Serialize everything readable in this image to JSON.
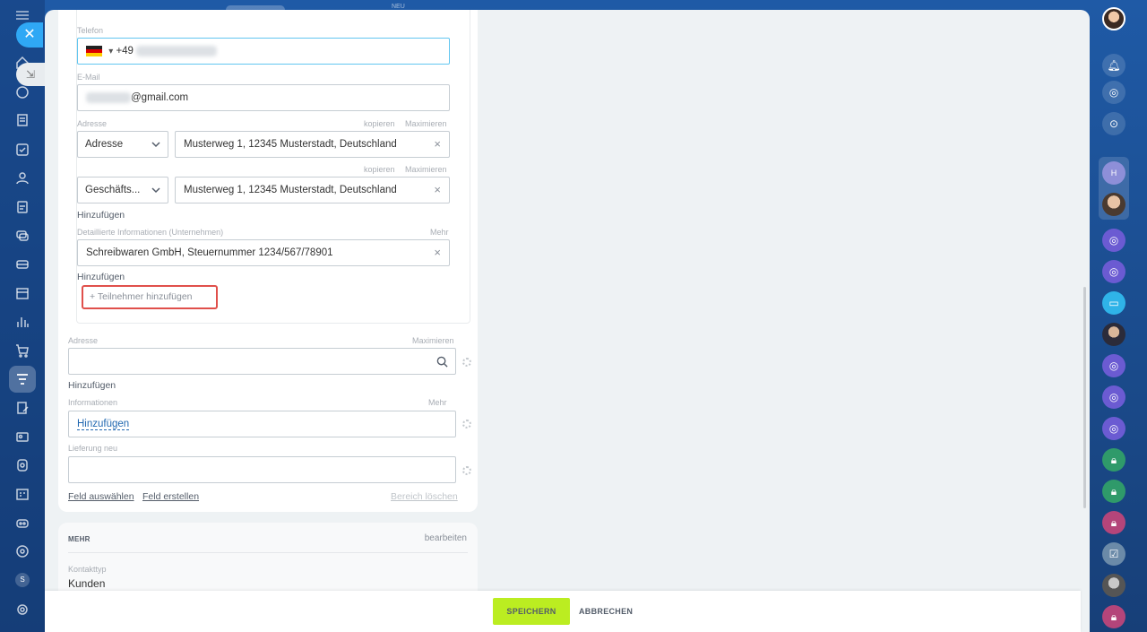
{
  "top": {
    "badge_new": "NEU"
  },
  "form": {
    "phone": {
      "label": "Telefon",
      "prefix": "+49"
    },
    "email": {
      "label": "E-Mail",
      "value_suffix": "@gmail.com"
    },
    "address_block": {
      "label": "Adresse",
      "copy": "kopieren",
      "maximize": "Maximieren",
      "rows": [
        {
          "type": "Adresse",
          "value": "Musterweg 1, 12345 Musterstadt, Deutschland"
        },
        {
          "type": "Geschäfts...",
          "value": "Musterweg 1, 12345 Musterstadt, Deutschland"
        }
      ],
      "add": "Hinzufügen"
    },
    "details": {
      "label": "Detaillierte Informationen (Unternehmen)",
      "more": "Mehr",
      "value": "Schreibwaren GmbH, Steuernummer 1234/567/78901",
      "add": "Hinzufügen"
    },
    "add_participant": "+ Teilnehmer hinzufügen",
    "address2": {
      "label": "Adresse",
      "maximize": "Maximieren",
      "value": "",
      "add": "Hinzufügen"
    },
    "information": {
      "label": "Informationen",
      "more": "Mehr",
      "link": "Hinzufügen"
    },
    "delivery": {
      "label": "Lieferung neu",
      "value": ""
    },
    "footer_links": {
      "select_field": "Feld auswählen",
      "create_field": "Feld erstellen",
      "delete_section": "Bereich löschen"
    }
  },
  "more_section": {
    "title": "MEHR",
    "edit": "bearbeiten",
    "contact_type_label": "Kontakttyp",
    "contact_type_value": "Kunden"
  },
  "actions": {
    "save": "SPEICHERN",
    "cancel": "ABBRECHEN"
  },
  "left_nav": {
    "initial": "S"
  },
  "right_rail": {
    "group_initial": "H"
  },
  "colors": {
    "accent_green": "#bbed21",
    "highlight_red": "#e0504b",
    "link_blue": "#2067b0",
    "panel_blue": "#2fa8f5"
  }
}
